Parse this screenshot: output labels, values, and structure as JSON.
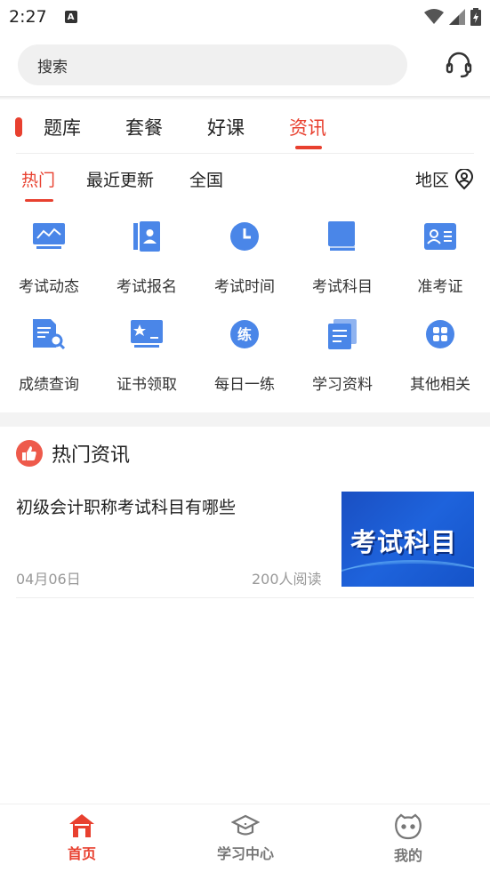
{
  "status_bar": {
    "time": "2:27",
    "notification_glyph": "A"
  },
  "search": {
    "placeholder": "搜索"
  },
  "main_tabs": [
    {
      "label": "题库"
    },
    {
      "label": "套餐"
    },
    {
      "label": "好课"
    },
    {
      "label": "资讯",
      "active": true
    }
  ],
  "sub_tabs": [
    {
      "label": "热门",
      "active": true
    },
    {
      "label": "最近更新"
    },
    {
      "label": "全国"
    }
  ],
  "region": {
    "label": "地区",
    "icon": "location-user-icon"
  },
  "grid": [
    {
      "label": "考试动态",
      "icon": "chart-line-icon"
    },
    {
      "label": "考试报名",
      "icon": "contact-book-icon"
    },
    {
      "label": "考试时间",
      "icon": "clock-icon"
    },
    {
      "label": "考试科目",
      "icon": "book-icon"
    },
    {
      "label": "准考证",
      "icon": "id-card-icon"
    },
    {
      "label": "成绩查询",
      "icon": "document-search-icon"
    },
    {
      "label": "证书领取",
      "icon": "certificate-icon"
    },
    {
      "label": "每日一练",
      "icon": "practice-badge-icon",
      "glyph": "练"
    },
    {
      "label": "学习资料",
      "icon": "documents-icon"
    },
    {
      "label": "其他相关",
      "icon": "apps-grid-icon"
    }
  ],
  "hot_news": {
    "title": "热门资讯",
    "items": [
      {
        "title": "初级会计职称考试科目有哪些",
        "date": "04月06日",
        "reads": "200人阅读",
        "image_text": "考试科目"
      }
    ]
  },
  "bottom_nav": [
    {
      "label": "首页",
      "icon": "home-icon",
      "active": true
    },
    {
      "label": "学习中心",
      "icon": "graduation-cap-icon"
    },
    {
      "label": "我的",
      "icon": "smiley-face-icon"
    }
  ],
  "colors": {
    "accent": "#e8402f",
    "icon_blue": "#4a86e8"
  }
}
